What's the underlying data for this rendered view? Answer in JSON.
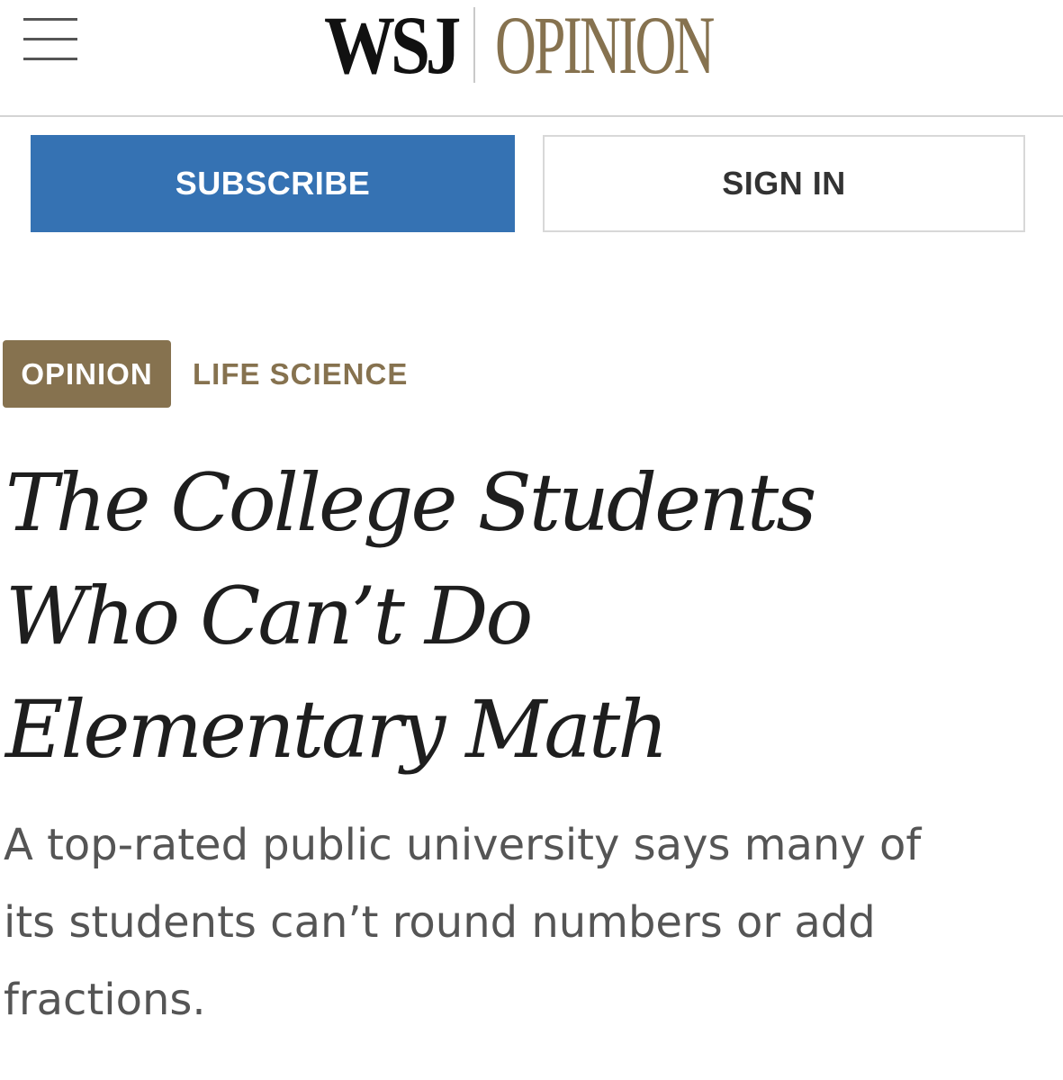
{
  "header": {
    "menu_icon": "hamburger-menu-icon",
    "logo_primary": "WSJ",
    "logo_section": "OPINION"
  },
  "buttons": {
    "subscribe_label": "SUBSCRIBE",
    "signin_label": "SIGN IN"
  },
  "tags": {
    "opinion_label": "OPINION",
    "section_label": "LIFE SCIENCE"
  },
  "article": {
    "headline_lines": [
      "The College Students",
      "Who Can’t Do",
      "Elementary Math"
    ],
    "dek_lines": [
      "A top-rated public university says many of",
      "its students can’t round numbers or add",
      "fractions."
    ]
  },
  "colors": {
    "subscribe_blue": "#3572b3",
    "opinion_gold": "#86724f",
    "headline_text": "#1e1e1e",
    "dek_text": "#555555"
  }
}
